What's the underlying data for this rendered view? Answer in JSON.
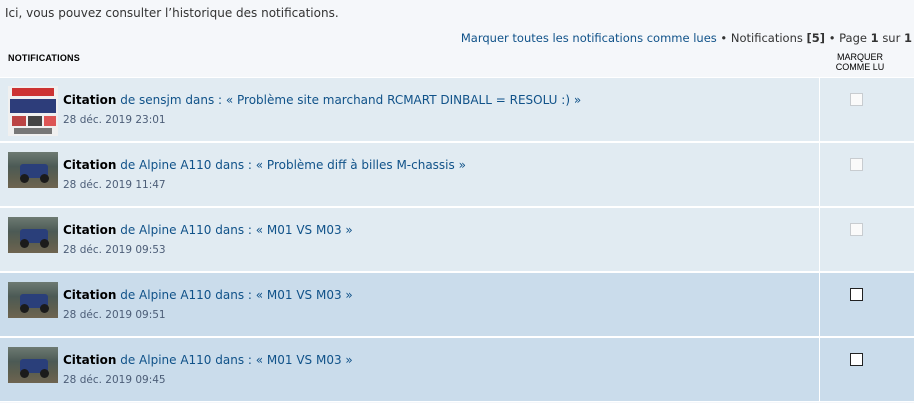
{
  "intro": "Ici, vous pouvez consulter l’historique des notifications.",
  "pagebar": {
    "mark_all": "Marquer toutes les notifications comme lues",
    "bullet": "•",
    "notifications_label": "Notifications",
    "count": "[5]",
    "page_label": "Page",
    "page_current": "1",
    "of_label": "sur",
    "page_total": "1"
  },
  "header": {
    "col_title": "NOTIFICATIONS",
    "col_mark_line1": "MARQUER",
    "col_mark_line2": "COMME LU"
  },
  "rows": [
    {
      "kind": "Citation",
      "text": "de sensjm dans : « Problème site marchand RCMART DINBALL = RESOLU :) »",
      "date": "28 déc. 2019 23:01",
      "avatar": "ad-image",
      "state": "read"
    },
    {
      "kind": "Citation",
      "text": "de Alpine A110 dans : « Problème diff à billes M-chassis »",
      "date": "28 déc. 2019 11:47",
      "avatar": "car-photo",
      "state": "read"
    },
    {
      "kind": "Citation",
      "text": "de Alpine A110 dans : « M01 VS M03 »",
      "date": "28 déc. 2019 09:53",
      "avatar": "car-photo",
      "state": "read"
    },
    {
      "kind": "Citation",
      "text": "de Alpine A110 dans : « M01 VS M03 »",
      "date": "28 déc. 2019 09:51",
      "avatar": "car-photo",
      "state": "unread"
    },
    {
      "kind": "Citation",
      "text": "de Alpine A110 dans : « M01 VS M03 »",
      "date": "28 déc. 2019 09:45",
      "avatar": "car-photo",
      "state": "unread"
    }
  ],
  "colors": {
    "link": "#105289",
    "read_bg": "#e1ebf2",
    "unread_bg": "#cadceb"
  }
}
